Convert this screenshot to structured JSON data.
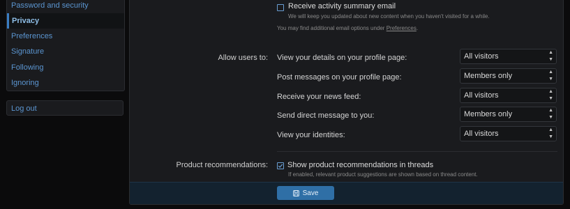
{
  "sidebar": {
    "items": [
      {
        "label": "Password and security"
      },
      {
        "label": "Privacy"
      },
      {
        "label": "Preferences"
      },
      {
        "label": "Signature"
      },
      {
        "label": "Following"
      },
      {
        "label": "Ignoring"
      }
    ],
    "logout_label": "Log out"
  },
  "email": {
    "checkbox_label": "Receive activity summary email",
    "checkbox_hint": "We will keep you updated about new content when you haven't visited for a while.",
    "options_text": "You may find additional email options under ",
    "options_link": "Preferences",
    "options_end": "."
  },
  "privacy": {
    "group_label": "Allow users to:",
    "rows": [
      {
        "label": "View your details on your profile page:",
        "value": "All visitors"
      },
      {
        "label": "Post messages on your profile page:",
        "value": "Members only"
      },
      {
        "label": "Receive your news feed:",
        "value": "All visitors"
      },
      {
        "label": "Send direct message to you:",
        "value": "Members only"
      },
      {
        "label": "View your identities:",
        "value": "All visitors"
      }
    ]
  },
  "recommendations": {
    "group_label": "Product recommendations:",
    "checkbox_label": "Show product recommendations in threads",
    "checkbox_checked": true,
    "hint": "If enabled, relevant product suggestions are shown based on thread content."
  },
  "footer": {
    "save_label": "Save"
  }
}
